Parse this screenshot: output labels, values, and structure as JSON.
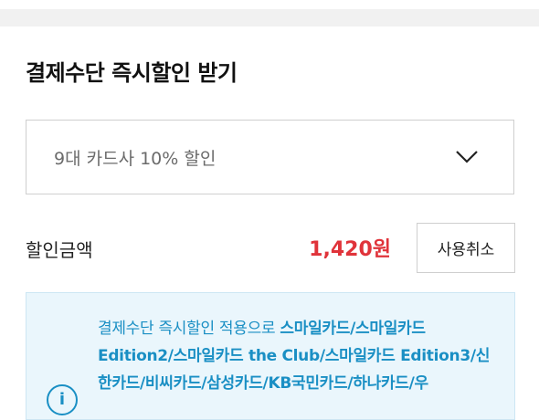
{
  "section_title": "결제수단 즉시할인 받기",
  "discount_select": {
    "selected_value": "9대 카드사 10% 할인"
  },
  "discount": {
    "label": "할인금액",
    "amount": "1,420원",
    "cancel_label": "사용취소"
  },
  "notice": {
    "prefix": "결제수단 즉시할인 적용으로 ",
    "cards": "스마일카드/스마일카드 Edition2/스마일카드 the Club/스마일카드 Edition3/신한카드/비씨카드/삼성카드/KB국민카드/하나카드/우"
  },
  "colors": {
    "accent_red": "#e0333a",
    "info_blue": "#1a8fc4",
    "info_bg": "#eaf6fc"
  },
  "icons": {
    "select": "chevron-down-icon",
    "notice": "info-icon"
  }
}
